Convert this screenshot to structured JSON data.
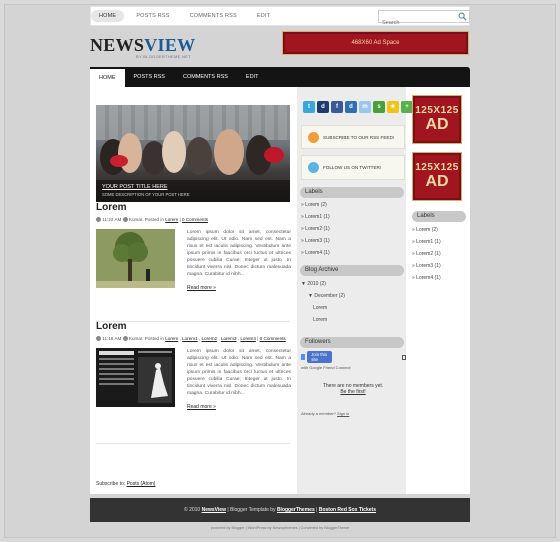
{
  "topnav": {
    "items": [
      "HOME",
      "POSTS RSS",
      "COMMENTS RSS",
      "EDIT"
    ],
    "search_placeholder": "Search"
  },
  "logo": {
    "news": "NEWS",
    "view": "VIEW",
    "tagline": "BY BLOGGERTHEME.NET"
  },
  "ad_top": "468X60 Ad Space",
  "mainnav": {
    "items": [
      "HOME",
      "POSTS RSS",
      "COMMENTS RSS",
      "EDIT"
    ]
  },
  "featured": {
    "title": "YOUR POST TITLE HERE",
    "desc": "SOME DESCRIPTION OF YOUR POST HERE"
  },
  "posts": [
    {
      "title": "Lorem",
      "meta_time": "11:22 AM",
      "meta_author": "Kumar",
      "meta_posted": ", Posted in",
      "meta_labels": [
        "Lorem"
      ],
      "meta_comments": "0 Comments",
      "body": "Lorem ipsum dolor sit amet, consectetur adipiscing elit. Ut odio. Nam sed est. Nam a risus et est iaculis adipiscing. Vestibulum ante ipsum primis in faucibus orci luctus et ultrices posuere cubilia Curae; Integer ut justo. In tincidunt viverra nisl. Donec dictum malesuada magna. Curabitur id nibh...",
      "read_more": "Read more »"
    },
    {
      "title": "Lorem",
      "meta_time": "11:16 AM",
      "meta_author": "Kumar",
      "meta_posted": ", Posted in",
      "meta_labels": [
        "Lorem",
        "Lorem1",
        "Lorem2",
        "Lorem3",
        "Lorem4"
      ],
      "meta_comments": "0 Comments",
      "body": "Lorem ipsum dolor sit amet, consectetur adipiscing elit. Ut odio. Nam sed est. Nam a risus et est iaculis adipiscing. Vestibulum ante ipsum primis in faucibus orci luctus et ultrices posuere cubilia Curae; Integer ut justo. In tincidunt viverra nisl. Donec dictum malesuada magna. Curabitur id nibh...",
      "read_more": "Read more »"
    }
  ],
  "subscribe": {
    "label": "Subscribe to:",
    "link": "Posts (Atom)"
  },
  "sidebar": {
    "rss_box": "SUBSCRIBE TO OUR RSS FEED!",
    "twitter_box": "FOLLOW US ON TWITTER!",
    "labels_title": "Labels",
    "labels": [
      "Lorem (2)",
      "Lorem1 (1)",
      "Lorem2 (1)",
      "Lorem3 (1)",
      "Lorem4 (1)"
    ],
    "archive_title": "Blog Archive",
    "archive_year": "2010 (2)",
    "archive_month": "December (2)",
    "archive_posts": [
      "Lorem",
      "Lorem"
    ],
    "followers_title": "Followers",
    "join_btn": "Join this site",
    "gfc_text": "with Google Friend Connect",
    "no_members": "There are no members yet.",
    "be_first": "Be the first!",
    "already_member": "Already a member?",
    "sign_in": "Sign in"
  },
  "rightbar": {
    "ad_line1": "125X125",
    "ad_line2": "AD",
    "labels_title": "Labels",
    "labels": [
      "Lorem (2)",
      "Lorem1 (1)",
      "Lorem2 (1)",
      "Lorem3 (1)",
      "Lorem4 (1)"
    ]
  },
  "footer": {
    "copyright": "© 2010",
    "site_name": "NewsView",
    "blogger_template": "| Blogger Template by",
    "blogger_theme": "BloggerThemes",
    "sep": "|",
    "tickets": "Boston Red Sox Tickets"
  },
  "credits": {
    "powered": "powered by",
    "blogger": "Blogger",
    "wp": "| WordPress by",
    "newwp": "Newwpthemes",
    "converted": "| Converted by",
    "bt": "BloggerTheme"
  },
  "colors": {
    "ad_red": "#a11520",
    "ad_gold": "#d4b16a",
    "logo_blue": "#1b5a96",
    "nav_dark": "#141414"
  }
}
